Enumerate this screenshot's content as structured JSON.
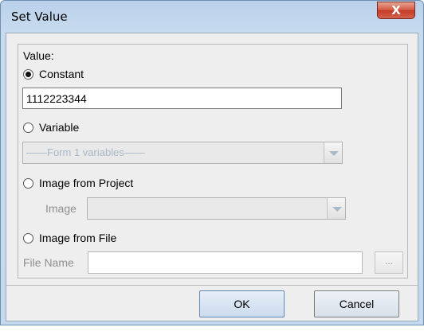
{
  "window": {
    "title": "Set Value",
    "close_glyph": "X"
  },
  "value_label": "Value:",
  "options": {
    "constant": {
      "label": "Constant",
      "selected": true,
      "value": "1112223344"
    },
    "variable": {
      "label": "Variable",
      "selected": false,
      "combo_value": "——Form 1 variables——"
    },
    "image_from_project": {
      "label": "Image from Project",
      "selected": false,
      "field_label": "Image",
      "combo_value": ""
    },
    "image_from_file": {
      "label": "Image from File",
      "selected": false,
      "field_label": "File Name",
      "file_value": "",
      "browse_label": "..."
    }
  },
  "buttons": {
    "ok": "OK",
    "cancel": "Cancel"
  },
  "colors": {
    "title_bar": "#c5d9ee",
    "close_button": "#c94a35",
    "dialog_bg": "#eeeeee"
  }
}
